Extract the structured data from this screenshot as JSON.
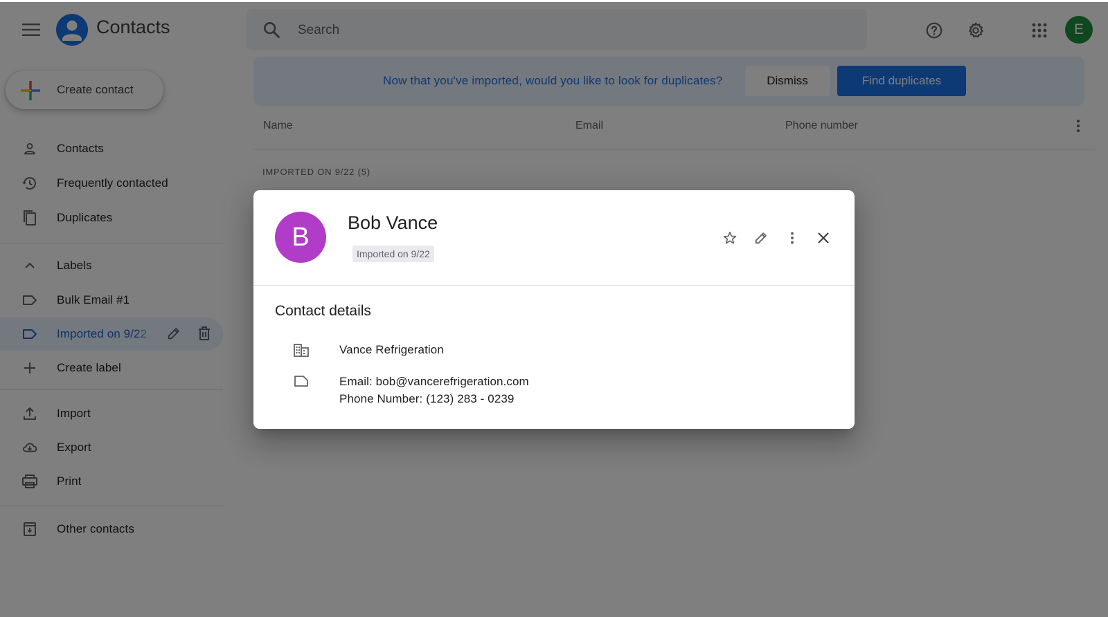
{
  "app": {
    "title": "Contacts"
  },
  "search": {
    "placeholder": "Search"
  },
  "header": {
    "icons": [
      "help-icon",
      "settings-icon",
      "apps-grid-icon"
    ],
    "account_initial": "E"
  },
  "sidebar": {
    "create_label": "Create contact",
    "items": [
      {
        "label": "Contacts",
        "icon": "person-icon"
      },
      {
        "label": "Frequently contacted",
        "icon": "history-icon"
      },
      {
        "label": "Duplicates",
        "icon": "copy-icon"
      },
      {
        "label": "Labels",
        "icon": "chevron-up-icon"
      },
      {
        "label": "Bulk Email #1",
        "icon": "label-icon"
      },
      {
        "label": "Imported on 9/22",
        "icon": "label-icon",
        "active": true
      },
      {
        "label": "Create label",
        "icon": "plus-icon"
      },
      {
        "label": "Import",
        "icon": "upload-icon"
      },
      {
        "label": "Export",
        "icon": "cloud-download-icon"
      },
      {
        "label": "Print",
        "icon": "print-icon"
      },
      {
        "label": "Other contacts",
        "icon": "archive-icon"
      }
    ]
  },
  "banner": {
    "text": "Now that you've imported, would you like to look for duplicates?",
    "dismiss_label": "Dismiss",
    "find_label": "Find duplicates"
  },
  "table": {
    "columns": [
      "Name",
      "Email",
      "Phone number"
    ],
    "group_label": "IMPORTED ON 9/22 (5)"
  },
  "dialog": {
    "avatar_initial": "B",
    "avatar_color": "#b03cc8",
    "name": "Bob Vance",
    "chip": "Imported on 9/22",
    "section_title": "Contact details",
    "company": "Vance Refrigeration",
    "note_line1": "Email: bob@vancerefrigeration.com",
    "note_line2": "Phone Number: (123) 283 - 0239"
  },
  "colors": {
    "accent": "#1a73e8",
    "scrim": "rgba(0,0,0,0.5)"
  }
}
